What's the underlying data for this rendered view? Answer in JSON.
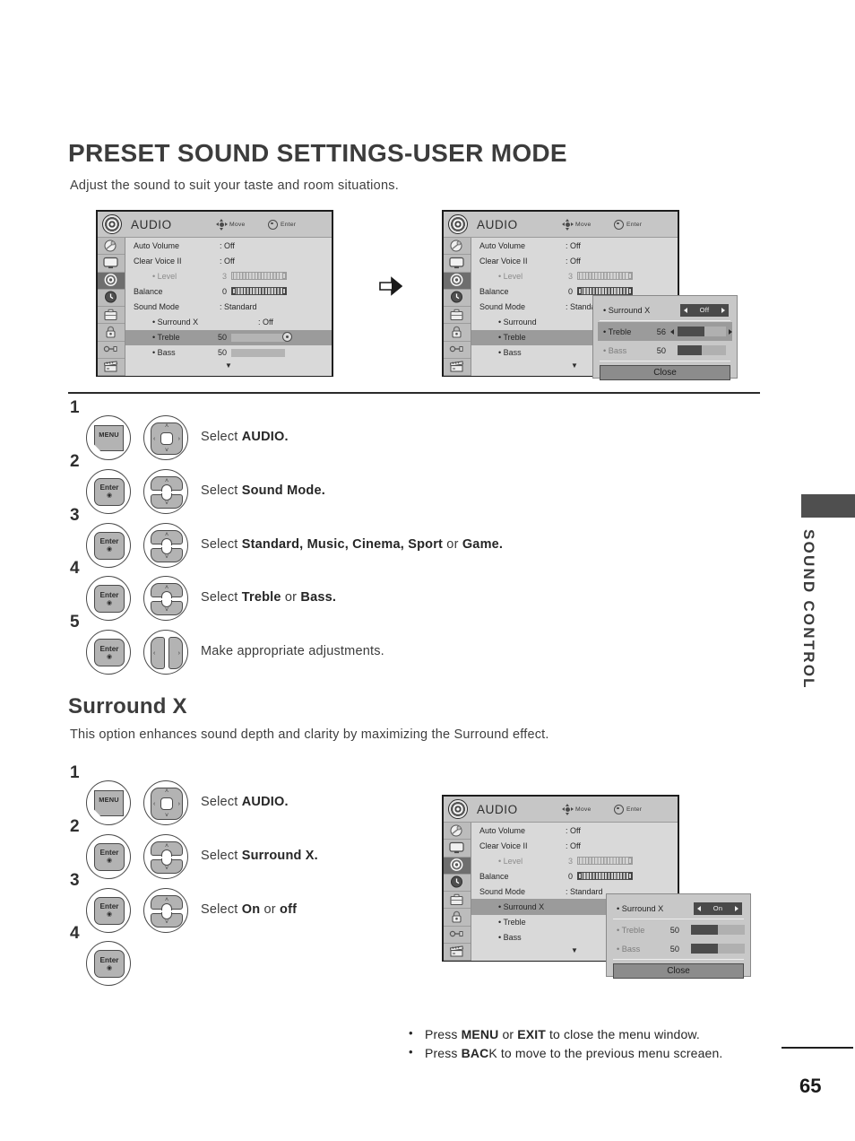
{
  "page": {
    "title": "PRESET SOUND SETTINGS-USER MODE",
    "subtitle": "Adjust the sound to suit your taste and room situations.",
    "section_title": "Surround X",
    "section_subtitle": "This option enhances sound depth and clarity by maximizing the Surround effect.",
    "side_tab_label": "SOUND CONTROL",
    "page_number": "65"
  },
  "osd_common": {
    "title": "AUDIO",
    "hint_move": "Move",
    "hint_enter": "Enter",
    "down_caret": "▼",
    "rail_icons": [
      "setup-antenna-icon",
      "picture-tv-icon",
      "audio-speaker-icon",
      "time-clock-icon",
      "option-case-icon",
      "lock-padlock-icon",
      "input-plug-icon",
      "usb-clapper-icon"
    ],
    "rail_active_index": 2
  },
  "osd_a": {
    "rows": [
      {
        "label": "Auto Volume",
        "value": ": Off"
      },
      {
        "label": "Clear Voice II",
        "value": ": Off"
      },
      {
        "label": "• Level",
        "value": "3",
        "dim": true,
        "bar": "scale"
      },
      {
        "label": "Balance",
        "value": "0",
        "bar": "scale"
      },
      {
        "label": "Sound Mode",
        "value": ": Standard"
      },
      {
        "label": "• Surround X",
        "value": ": Off"
      },
      {
        "label": "• Treble",
        "value": "50",
        "bar": "slider",
        "highlight": true
      },
      {
        "label": "• Bass",
        "value": "50",
        "bar": "slider"
      }
    ]
  },
  "osd_b": {
    "rows": [
      {
        "label": "Auto Volume",
        "value": ": Off"
      },
      {
        "label": "Clear Voice II",
        "value": ": Off"
      },
      {
        "label": "• Level",
        "value": "3",
        "dim": true,
        "bar": "scale"
      },
      {
        "label": "Balance",
        "value": "0",
        "bar": "scale"
      },
      {
        "label": "Sound Mode",
        "value": ": Standard"
      },
      {
        "label": "• Surround",
        "value": ""
      },
      {
        "label": "• Treble",
        "value": "",
        "highlight": true
      },
      {
        "label": "• Bass",
        "value": ""
      }
    ],
    "popup": {
      "surround_label": "• Surround X",
      "surround_value": "Off",
      "treble_label": "• Treble",
      "treble_value": "56",
      "bass_label": "• Bass",
      "bass_value": "50",
      "close_label": "Close"
    }
  },
  "osd_c": {
    "rows": [
      {
        "label": "Auto Volume",
        "value": ": Off"
      },
      {
        "label": "Clear Voice II",
        "value": ": Off"
      },
      {
        "label": "• Level",
        "value": "3",
        "dim": true,
        "bar": "scale"
      },
      {
        "label": "Balance",
        "value": "0",
        "bar": "scale"
      },
      {
        "label": "Sound Mode",
        "value": ": Standard"
      },
      {
        "label": "• Surround X",
        "value": "",
        "highlight": true
      },
      {
        "label": "• Treble",
        "value": ""
      },
      {
        "label": "• Bass",
        "value": ""
      }
    ],
    "popup": {
      "surround_label": "• Surround X",
      "surround_value": "On",
      "treble_label": "• Treble",
      "treble_value": "50",
      "bass_label": "• Bass",
      "bass_value": "50",
      "close_label": "Close"
    }
  },
  "steps_top": [
    {
      "num": "1",
      "button": "MENU",
      "pad": "four-way",
      "text_parts": [
        {
          "t": "Select ",
          "b": false
        },
        {
          "t": "AUDIO.",
          "b": true
        }
      ]
    },
    {
      "num": "2",
      "button": "Enter",
      "pad": "up-down",
      "text_parts": [
        {
          "t": "Select ",
          "b": false
        },
        {
          "t": "Sound Mode.",
          "b": true
        }
      ]
    },
    {
      "num": "3",
      "button": "Enter",
      "pad": "up-down",
      "text_parts": [
        {
          "t": "Select ",
          "b": false
        },
        {
          "t": "Standard, Music, Cinema, Sport",
          "b": true
        },
        {
          "t": " or ",
          "b": false
        },
        {
          "t": "Game.",
          "b": true
        }
      ]
    },
    {
      "num": "4",
      "button": "Enter",
      "pad": "up-down",
      "text_parts": [
        {
          "t": "Select ",
          "b": false
        },
        {
          "t": "Treble",
          "b": true
        },
        {
          "t": " or ",
          "b": false
        },
        {
          "t": "Bass.",
          "b": true
        }
      ]
    },
    {
      "num": "5",
      "button": "Enter",
      "pad": "left-right",
      "text_parts": [
        {
          "t": "Make appropriate adjustments.",
          "b": false
        }
      ]
    }
  ],
  "steps_bottom": [
    {
      "num": "1",
      "button": "MENU",
      "pad": "four-way",
      "text_parts": [
        {
          "t": "Select ",
          "b": false
        },
        {
          "t": "AUDIO.",
          "b": true
        }
      ]
    },
    {
      "num": "2",
      "button": "Enter",
      "pad": "up-down",
      "text_parts": [
        {
          "t": "Select ",
          "b": false
        },
        {
          "t": "Surround X.",
          "b": true
        }
      ]
    },
    {
      "num": "3",
      "button": "Enter",
      "pad": "up-down",
      "text_parts": [
        {
          "t": "Select ",
          "b": false
        },
        {
          "t": "On",
          "b": true
        },
        {
          "t": " or ",
          "b": false
        },
        {
          "t": "off",
          "b": true
        }
      ]
    },
    {
      "num": "4",
      "button": "Enter",
      "pad": "none",
      "text_parts": []
    }
  ],
  "enter_button": {
    "label": "Enter",
    "dot": "◉"
  },
  "notes": [
    [
      {
        "t": "Press ",
        "b": false
      },
      {
        "t": "MENU",
        "b": true
      },
      {
        "t": " or ",
        "b": false
      },
      {
        "t": "EXIT",
        "b": true
      },
      {
        "t": " to close the menu window.",
        "b": false
      }
    ],
    [
      {
        "t": "Press ",
        "b": false
      },
      {
        "t": "BAC",
        "b": true
      },
      {
        "t": "K to move to the previous menu screaen.",
        "b": false
      }
    ]
  ],
  "colors": {
    "osd_bg": "#d9d9d9",
    "osd_header": "#c6c6c6",
    "osd_rail": "#bcbcbc",
    "highlight": "#9b9b9b",
    "rail_active": "#6e6e6e",
    "slider_fill": "#4c4c4c",
    "toggle_bg": "#4a4a4a",
    "text": "#3a3a3a",
    "side_tab": "#4f4f4f"
  }
}
